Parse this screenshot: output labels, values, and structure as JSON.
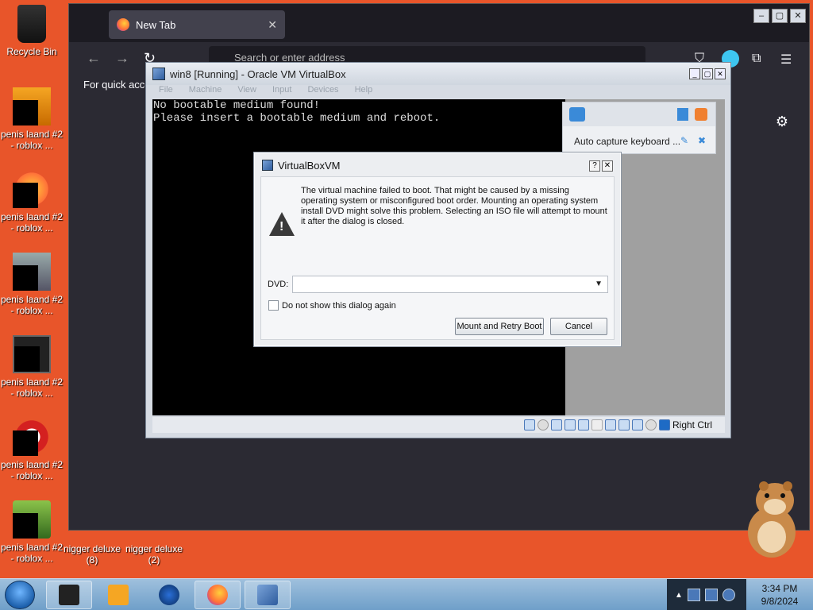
{
  "desktop": {
    "icons": [
      {
        "label": "Recycle Bin"
      },
      {
        "label": "penis laand #2 - roblox ..."
      },
      {
        "label": "penis laand #2 - roblox ..."
      },
      {
        "label": "penis laand #2 - roblox ..."
      },
      {
        "label": "penis laand #2 - roblox ..."
      },
      {
        "label": "penis laand #2 - roblox ..."
      },
      {
        "label": "penis laand #2 - roblox ..."
      },
      {
        "label": "nigger deluxe (8)"
      },
      {
        "label": "nigger deluxe (2)"
      }
    ]
  },
  "firefox": {
    "tab_title": "New Tab",
    "url_placeholder": "Search or enter address",
    "bookmarks_text": "For quick access"
  },
  "virtualbox": {
    "title": "win8 [Running] - Oracle VM VirtualBox",
    "menu": [
      "File",
      "Machine",
      "View",
      "Input",
      "Devices",
      "Help"
    ],
    "screen_lines": [
      "No bootable medium found!",
      "Please insert a bootable medium and reboot."
    ],
    "notification_text": "Auto capture keyboard ...",
    "host_key": "Right Ctrl"
  },
  "dialog": {
    "title": "VirtualBoxVM",
    "message": "The virtual machine failed to boot. That might be caused by a missing operating system or misconfigured boot order. Mounting an operating system install DVD might solve this problem. Selecting an ISO file will attempt to mount it after the dialog is closed.",
    "dvd_label": "DVD:",
    "dvd_value": "",
    "checkbox_label": "Do not show this dialog again",
    "mount_button": "Mount and Retry Boot",
    "cancel_button": "Cancel"
  },
  "taskbar": {
    "time": "3:34 PM",
    "date": "9/8/2024"
  },
  "colors": {
    "desktop_bg": "#e8552a",
    "firefox_bg": "#2b2a33",
    "taskbar": "#8fb4d8"
  }
}
